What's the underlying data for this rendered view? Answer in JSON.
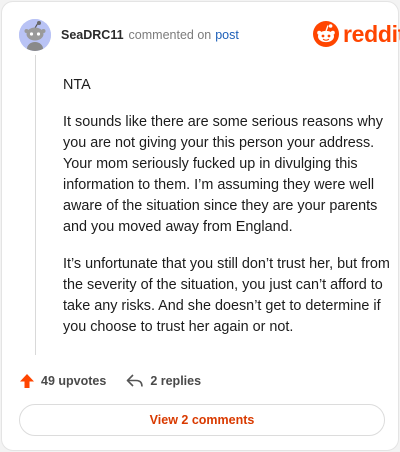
{
  "comment": {
    "username": "SeaDRC11",
    "commented_on": "commented on",
    "post_link": "post",
    "paragraphs": [
      "NTA",
      "It sounds like there are some serious reasons why you are not giving your this person your address. Your mom seriously fucked up in divulging this information to them. I’m assuming they were well aware of the situation since they are your parents and you moved away from England.",
      "It’s unfortunate that you still don’t trust her, but from the severity of the situation, you just can’t afford to take any risks. And she doesn’t get to determine if you choose to trust her again or not."
    ]
  },
  "brand": {
    "name": "reddit",
    "color": "#ff4500"
  },
  "actions": {
    "upvotes": "49 upvotes",
    "replies": "2 replies"
  },
  "footer": {
    "view_comments": "View 2 comments"
  },
  "icons": {
    "avatar": "snoo-avatar-icon",
    "logo": "reddit-alien-icon",
    "upvote": "upvote-arrow-icon",
    "reply": "reply-arrow-icon"
  }
}
